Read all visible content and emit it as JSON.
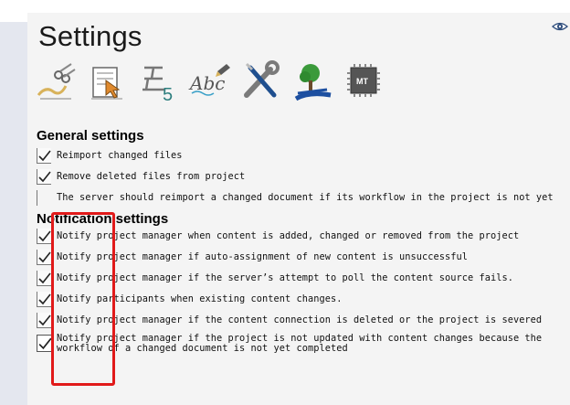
{
  "page": {
    "title": "Settings"
  },
  "toolbar": {
    "tools": [
      {
        "icon": "signature-scissors-icon"
      },
      {
        "icon": "document-cursor-icon"
      },
      {
        "icon": "character-five-icon"
      },
      {
        "icon": "spellcheck-abc-icon"
      },
      {
        "icon": "wrench-screwdriver-icon"
      },
      {
        "icon": "tree-road-icon"
      },
      {
        "icon": "machine-translation-chip-icon",
        "label": "MT"
      }
    ]
  },
  "general": {
    "heading": "General settings",
    "items": [
      {
        "label": "Reimport changed files",
        "checked": true
      },
      {
        "label": "Remove deleted files from project",
        "checked": true
      },
      {
        "label": "The server should reimport a changed document if its workflow in the project is not yet",
        "checked": false
      }
    ]
  },
  "notification": {
    "heading": "Notification settings",
    "items": [
      {
        "label": "Notify project manager when content is added, changed or removed from the project",
        "checked": true
      },
      {
        "label": "Notify project manager if auto-assignment of new content is unsuccessful",
        "checked": true
      },
      {
        "label": "Notify project manager if the server’s attempt to poll the content source fails.",
        "checked": true
      },
      {
        "label": "Notify participants when existing content changes.",
        "checked": true
      },
      {
        "label": "Notify project manager if the content connection is deleted or the project is severed",
        "checked": true
      },
      {
        "label": "Notify project manager if the project is not updated with content changes because the workflow of a changed document is not yet completed",
        "checked": true
      }
    ]
  },
  "colors": {
    "highlight": "#e11a1a",
    "panel": "#f4f4f4"
  }
}
